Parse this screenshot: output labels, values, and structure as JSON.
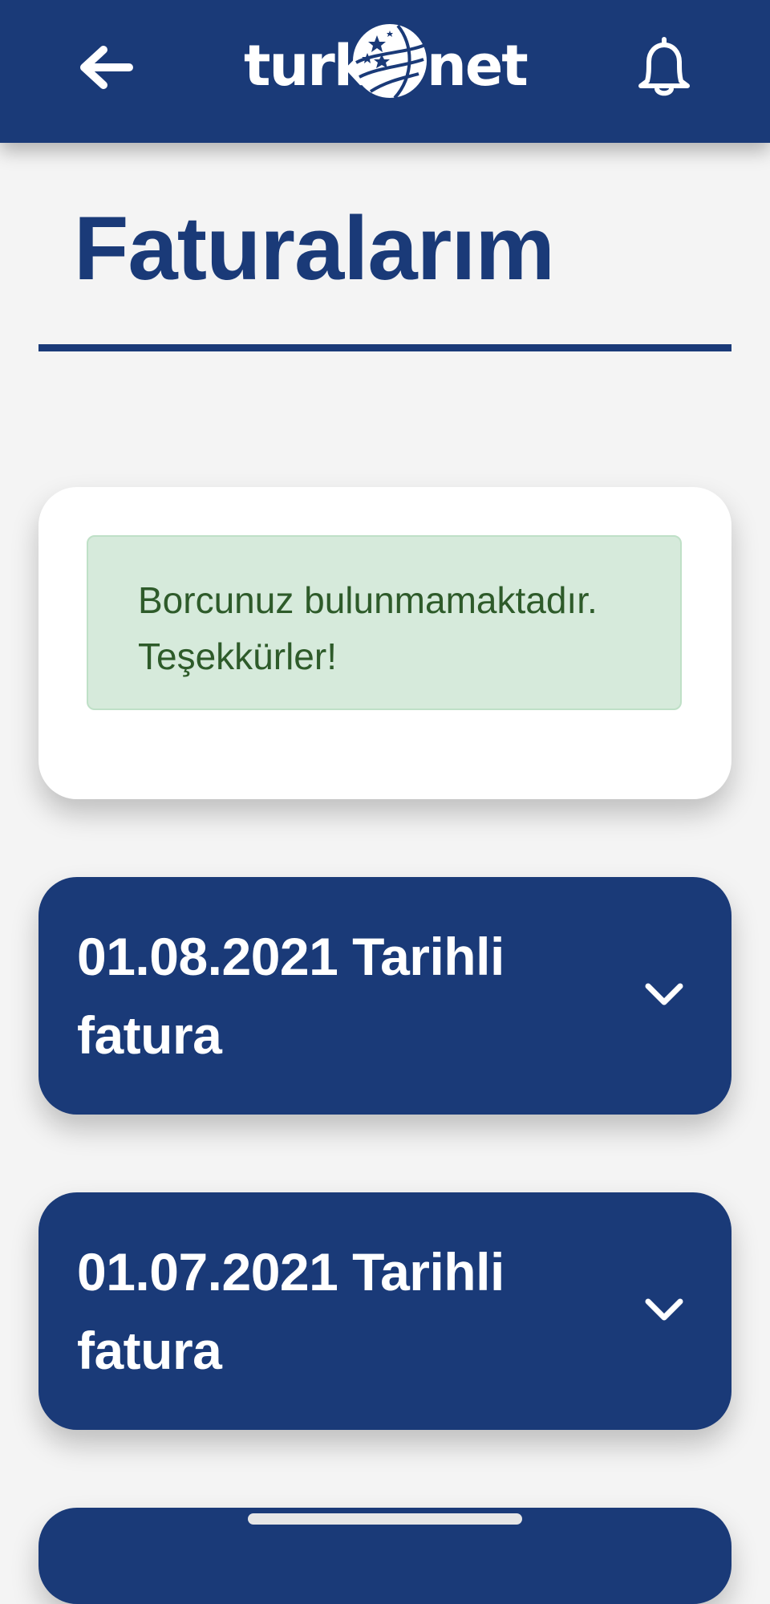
{
  "header": {
    "back_icon": "arrow-left-icon",
    "notifications_icon": "bell-icon",
    "logo": {
      "left_text": "turk",
      "right_text": "net",
      "globe_icon": "globe-stars-icon"
    },
    "background_color": "#1a3a78"
  },
  "page": {
    "title": "Faturalarım"
  },
  "status_card": {
    "line1": "Borcunuz bulunmamaktadır.",
    "line2": "Teşekkürler!",
    "alert_color": "#d6eadb",
    "text_color": "#2e5b2a"
  },
  "invoices": [
    {
      "line1": "01.08.2021 Tarihli",
      "line2": "fatura",
      "expand_icon": "chevron-down-icon"
    },
    {
      "line1": "01.07.2021 Tarihli",
      "line2": "fatura",
      "expand_icon": "chevron-down-icon"
    }
  ],
  "colors": {
    "brand_blue": "#1a3a78",
    "page_background": "#f4f4f4"
  }
}
